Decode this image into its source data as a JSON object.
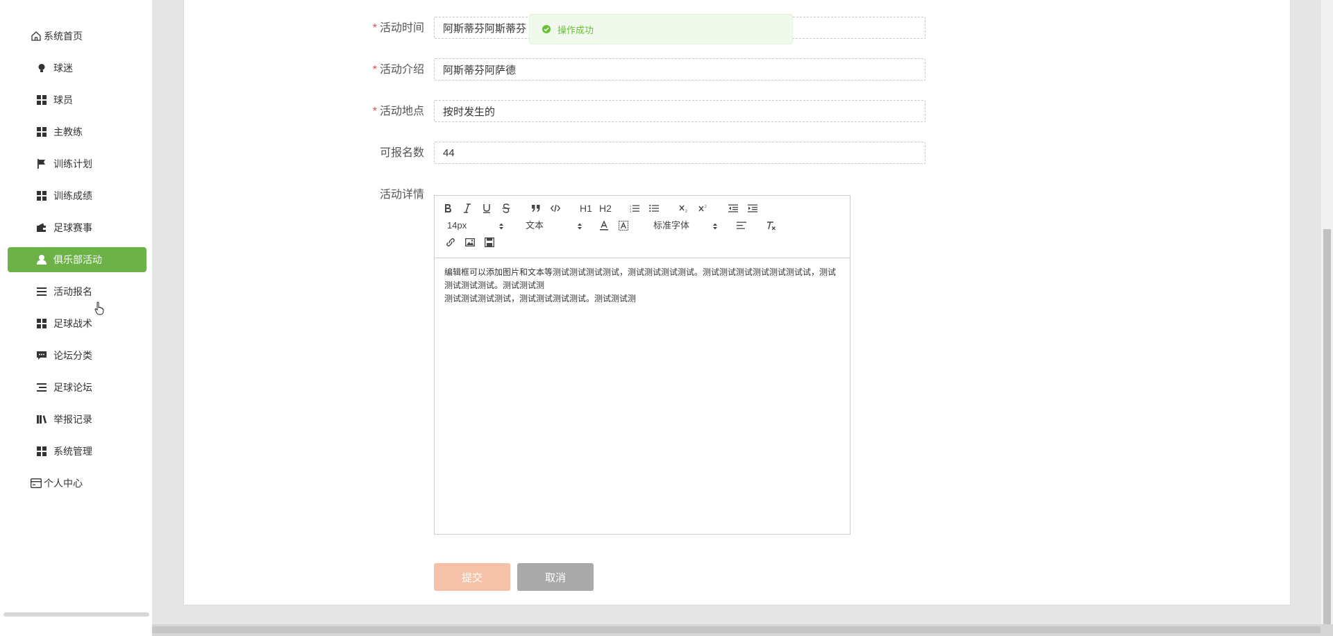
{
  "sidebar": {
    "items": [
      {
        "label": "系统首页",
        "icon": "home-icon",
        "kind": "top"
      },
      {
        "label": "球迷",
        "icon": "bulb-icon",
        "kind": "sub"
      },
      {
        "label": "球员",
        "icon": "grid-icon",
        "kind": "sub"
      },
      {
        "label": "主教练",
        "icon": "grid-icon",
        "kind": "sub"
      },
      {
        "label": "训练计划",
        "icon": "flag-icon",
        "kind": "sub"
      },
      {
        "label": "训练成绩",
        "icon": "grid-icon",
        "kind": "sub"
      },
      {
        "label": "足球赛事",
        "icon": "wallet-icon",
        "kind": "sub"
      },
      {
        "label": "俱乐部活动",
        "icon": "user-icon",
        "kind": "sub",
        "active": true
      },
      {
        "label": "活动报名",
        "icon": "list-icon",
        "kind": "sub"
      },
      {
        "label": "足球战术",
        "icon": "grid-icon",
        "kind": "sub"
      },
      {
        "label": "论坛分类",
        "icon": "comment-icon",
        "kind": "sub"
      },
      {
        "label": "足球论坛",
        "icon": "list-icon",
        "kind": "sub"
      },
      {
        "label": "举报记录",
        "icon": "books-icon",
        "kind": "sub"
      },
      {
        "label": "系统管理",
        "icon": "grid-icon",
        "kind": "sub"
      },
      {
        "label": "个人中心",
        "icon": "card-icon",
        "kind": "top"
      }
    ],
    "active_color": "#6cb246"
  },
  "form": {
    "time": {
      "label": "活动时间",
      "value": "阿斯蒂芬阿斯蒂芬",
      "required": "*"
    },
    "intro": {
      "label": "活动介绍",
      "value": "阿斯蒂芬阿萨德",
      "required": "*"
    },
    "place": {
      "label": "活动地点",
      "value": "按时发生的",
      "required": "*"
    },
    "quota": {
      "label": "可报名数",
      "value": "44"
    },
    "detail": {
      "label": "活动详情"
    }
  },
  "editor": {
    "font_size": "14px",
    "text_type": "文本",
    "font_family": "标准字体",
    "h1": "H1",
    "h2": "H2",
    "content": {
      "line1": "编辑框可以添加图片和文本等测试测试测试测试，测试测试测试测试。测试测试测试测试测试测试试，测试测试测试测试。测试测试测",
      "line2": "测试测试测试测试，测试测试测试测试。测试测试测"
    }
  },
  "buttons": {
    "submit": "提交",
    "cancel": "取消"
  },
  "toast": {
    "message": "操作成功",
    "color": "#67c23a"
  }
}
